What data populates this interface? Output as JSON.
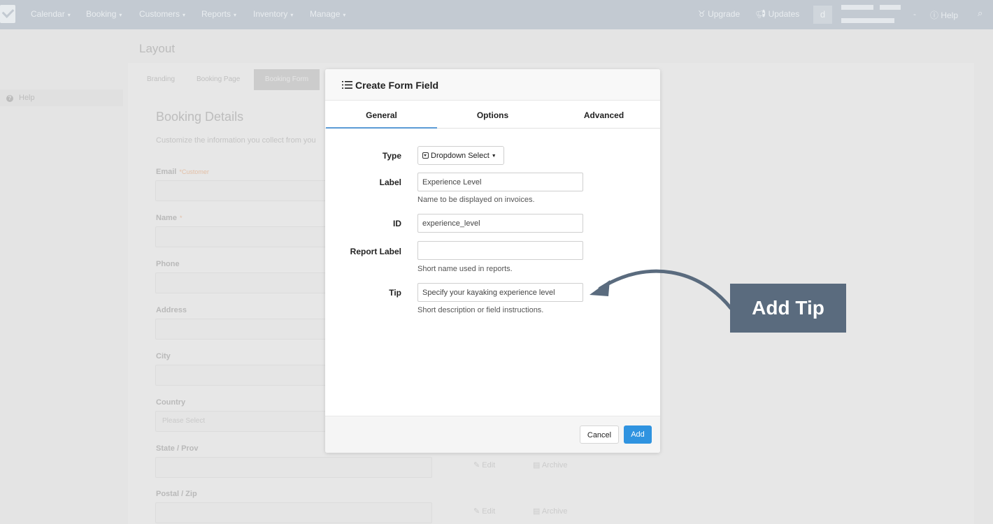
{
  "nav": {
    "items": [
      "Calendar",
      "Booking",
      "Customers",
      "Reports",
      "Inventory",
      "Manage"
    ],
    "caret": "▾",
    "upgrade": "Upgrade",
    "updates": "Updates",
    "avatar_letter": "d",
    "dash": "-",
    "help": "Help"
  },
  "page": {
    "title": "Layout",
    "side_help": "Help",
    "tabs": [
      "Branding",
      "Booking Page",
      "Booking Form"
    ],
    "heading": "Booking Details",
    "description": "Customize the information you collect from you",
    "fields": [
      {
        "label": "Email",
        "req": "*Customer"
      },
      {
        "label": "Name",
        "req": "*"
      },
      {
        "label": "Phone",
        "req": ""
      },
      {
        "label": "Address",
        "req": ""
      },
      {
        "label": "City",
        "req": ""
      },
      {
        "label": "Country",
        "req": ""
      },
      {
        "label": "State / Prov",
        "req": ""
      },
      {
        "label": "Postal / Zip",
        "req": ""
      }
    ],
    "country_placeholder": "Please Select",
    "edit": "Edit",
    "archive": "Archive"
  },
  "modal": {
    "title": "Create Form Field",
    "tabs": [
      "General",
      "Options",
      "Advanced"
    ],
    "type_label": "Type",
    "type_value": "Dropdown Select",
    "label_label": "Label",
    "label_value": "Experience Level",
    "label_help": "Name to be displayed on invoices.",
    "id_label": "ID",
    "id_value": "experience_level",
    "report_label_label": "Report Label",
    "report_label_value": "",
    "report_label_help": "Short name used in reports.",
    "tip_label": "Tip",
    "tip_value": "Specify your kayaking experience level",
    "tip_help": "Short description or field instructions.",
    "cancel": "Cancel",
    "add": "Add"
  },
  "callout": {
    "text": "Add Tip",
    "color": "#5a6b7e"
  },
  "colors": {
    "accent": "#2f93e0",
    "tab_underline": "#5b9bd5",
    "nav_bg": "#c3cad2"
  }
}
